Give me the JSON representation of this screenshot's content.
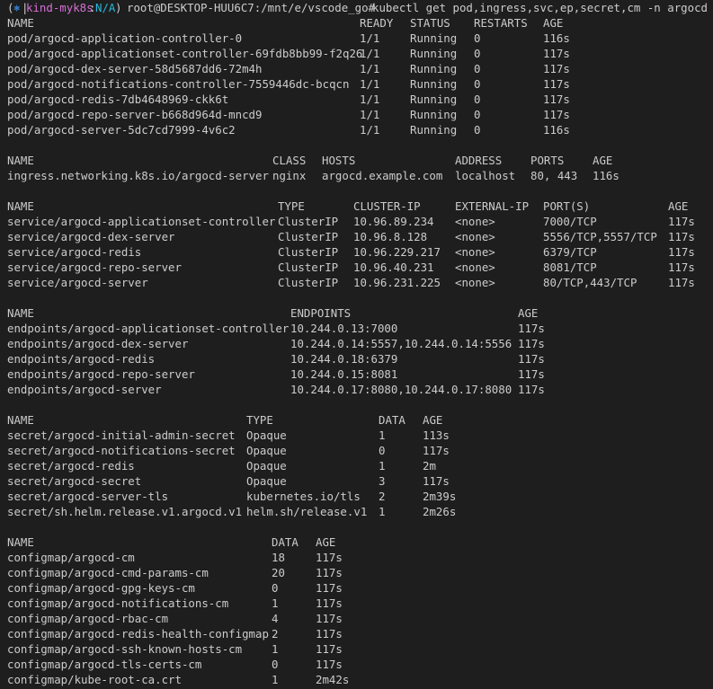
{
  "prompt": {
    "open": "(",
    "symbol": "⎈",
    "separator": "|",
    "context": "kind-myk8s",
    "colon": ":",
    "namespace": "N/A",
    "close": ")",
    "user_path": "root@DESKTOP-HUU6C7:/mnt/e/vscode_go#",
    "command": "kubectl get pod,ingress,svc,ep,secret,cm -n argocd"
  },
  "colors": {
    "background": "#1e1e1e",
    "text": "#cccccc",
    "prompt_blue": "#3b8eea",
    "prompt_magenta": "#d670d6",
    "prompt_cyan": "#29b8db"
  },
  "pods": {
    "headers": [
      "NAME",
      "READY",
      "STATUS",
      "RESTARTS",
      "AGE"
    ],
    "rows": [
      [
        "pod/argocd-application-controller-0",
        "1/1",
        "Running",
        "0",
        "116s"
      ],
      [
        "pod/argocd-applicationset-controller-69fdb8bb99-f2q26",
        "1/1",
        "Running",
        "0",
        "117s"
      ],
      [
        "pod/argocd-dex-server-58d5687dd6-72m4h",
        "1/1",
        "Running",
        "0",
        "117s"
      ],
      [
        "pod/argocd-notifications-controller-7559446dc-bcqcn",
        "1/1",
        "Running",
        "0",
        "117s"
      ],
      [
        "pod/argocd-redis-7db4648969-ckk6t",
        "1/1",
        "Running",
        "0",
        "117s"
      ],
      [
        "pod/argocd-repo-server-b668d964d-mncd9",
        "1/1",
        "Running",
        "0",
        "117s"
      ],
      [
        "pod/argocd-server-5dc7cd7999-4v6c2",
        "1/1",
        "Running",
        "0",
        "116s"
      ]
    ]
  },
  "ingress": {
    "headers": [
      "NAME",
      "CLASS",
      "HOSTS",
      "ADDRESS",
      "PORTS",
      "AGE"
    ],
    "rows": [
      [
        "ingress.networking.k8s.io/argocd-server",
        "nginx",
        "argocd.example.com",
        "localhost",
        "80, 443",
        "116s"
      ]
    ]
  },
  "services": {
    "headers": [
      "NAME",
      "TYPE",
      "CLUSTER-IP",
      "EXTERNAL-IP",
      "PORT(S)",
      "AGE"
    ],
    "rows": [
      [
        "service/argocd-applicationset-controller",
        "ClusterIP",
        "10.96.89.234",
        "<none>",
        "7000/TCP",
        "117s"
      ],
      [
        "service/argocd-dex-server",
        "ClusterIP",
        "10.96.8.128",
        "<none>",
        "5556/TCP,5557/TCP",
        "117s"
      ],
      [
        "service/argocd-redis",
        "ClusterIP",
        "10.96.229.217",
        "<none>",
        "6379/TCP",
        "117s"
      ],
      [
        "service/argocd-repo-server",
        "ClusterIP",
        "10.96.40.231",
        "<none>",
        "8081/TCP",
        "117s"
      ],
      [
        "service/argocd-server",
        "ClusterIP",
        "10.96.231.225",
        "<none>",
        "80/TCP,443/TCP",
        "117s"
      ]
    ]
  },
  "endpoints": {
    "headers": [
      "NAME",
      "ENDPOINTS",
      "AGE"
    ],
    "rows": [
      [
        "endpoints/argocd-applicationset-controller",
        "10.244.0.13:7000",
        "117s"
      ],
      [
        "endpoints/argocd-dex-server",
        "10.244.0.14:5557,10.244.0.14:5556",
        "117s"
      ],
      [
        "endpoints/argocd-redis",
        "10.244.0.18:6379",
        "117s"
      ],
      [
        "endpoints/argocd-repo-server",
        "10.244.0.15:8081",
        "117s"
      ],
      [
        "endpoints/argocd-server",
        "10.244.0.17:8080,10.244.0.17:8080",
        "117s"
      ]
    ]
  },
  "secrets": {
    "headers": [
      "NAME",
      "TYPE",
      "DATA",
      "AGE"
    ],
    "rows": [
      [
        "secret/argocd-initial-admin-secret",
        "Opaque",
        "1",
        "113s"
      ],
      [
        "secret/argocd-notifications-secret",
        "Opaque",
        "0",
        "117s"
      ],
      [
        "secret/argocd-redis",
        "Opaque",
        "1",
        "2m"
      ],
      [
        "secret/argocd-secret",
        "Opaque",
        "3",
        "117s"
      ],
      [
        "secret/argocd-server-tls",
        "kubernetes.io/tls",
        "2",
        "2m39s"
      ],
      [
        "secret/sh.helm.release.v1.argocd.v1",
        "helm.sh/release.v1",
        "1",
        "2m26s"
      ]
    ]
  },
  "configmaps": {
    "headers": [
      "NAME",
      "DATA",
      "AGE"
    ],
    "rows": [
      [
        "configmap/argocd-cm",
        "18",
        "117s"
      ],
      [
        "configmap/argocd-cmd-params-cm",
        "20",
        "117s"
      ],
      [
        "configmap/argocd-gpg-keys-cm",
        "0",
        "117s"
      ],
      [
        "configmap/argocd-notifications-cm",
        "1",
        "117s"
      ],
      [
        "configmap/argocd-rbac-cm",
        "4",
        "117s"
      ],
      [
        "configmap/argocd-redis-health-configmap",
        "2",
        "117s"
      ],
      [
        "configmap/argocd-ssh-known-hosts-cm",
        "1",
        "117s"
      ],
      [
        "configmap/argocd-tls-certs-cm",
        "0",
        "117s"
      ],
      [
        "configmap/kube-root-ca.crt",
        "1",
        "2m42s"
      ]
    ]
  }
}
